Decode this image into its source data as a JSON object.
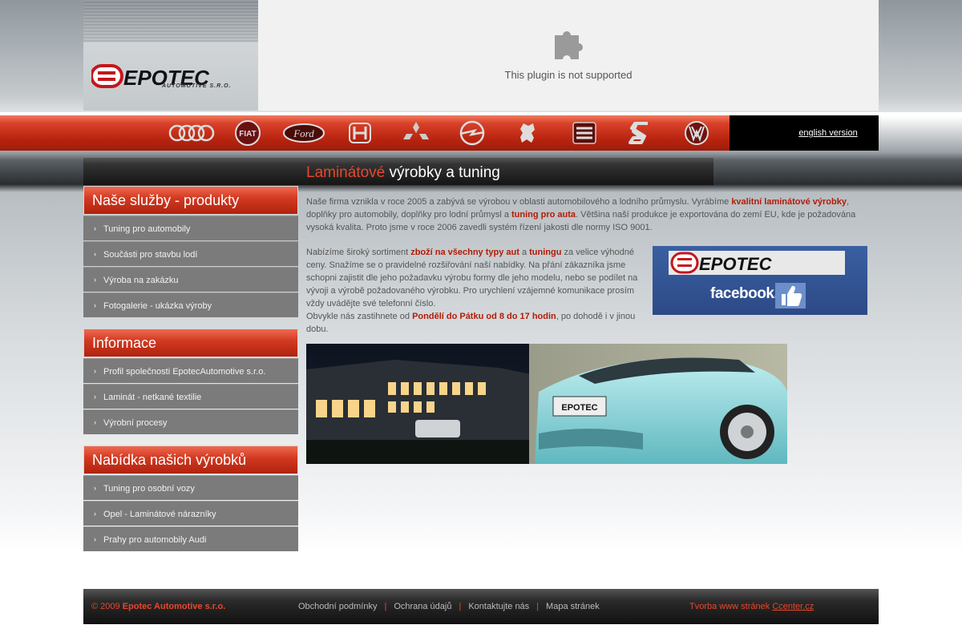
{
  "header": {
    "logo_text": "EPOTEC",
    "logo_subtext": "AUTOMOTIVE S.R.O.",
    "plugin_message": "This plugin is not supported"
  },
  "brands": [
    {
      "name": "audi-logo"
    },
    {
      "name": "fiat-logo"
    },
    {
      "name": "ford-logo"
    },
    {
      "name": "honda-logo"
    },
    {
      "name": "mitsubishi-logo"
    },
    {
      "name": "opel-logo"
    },
    {
      "name": "peugeot-logo"
    },
    {
      "name": "seat-logo"
    },
    {
      "name": "suzuki-logo"
    },
    {
      "name": "volkswagen-logo"
    },
    {
      "name": "skoda-logo"
    }
  ],
  "english_link": "english version",
  "page_title": {
    "highlight": "Laminátové",
    "rest": " výrobky a tuning"
  },
  "sidebar": {
    "sections": [
      {
        "title": "Naše služby - produkty",
        "items": [
          "Tuning pro automobily",
          "Součásti pro stavbu lodí",
          "Výroba na zakázku",
          "Fotogalerie - ukázka výroby"
        ]
      },
      {
        "title": "Informace",
        "items": [
          "Profil společnosti EpotecAutomotive s.r.o.",
          "Laminát - netkané textilie",
          "Výrobní procesy"
        ]
      },
      {
        "title": "Nabídka našich výrobků",
        "items": [
          "Tuning pro osobní vozy",
          "Opel - Laminátové nárazníky",
          "Prahy pro automobily Audi"
        ]
      }
    ]
  },
  "content": {
    "p1_a": "Naše firma vznikla v roce 2005 a zabývá se výrobou v oblasti automobilového a lodního průmyslu. Vyrábíme ",
    "p1_b": "kvalitní laminátové výrobky",
    "p1_c": ", doplňky pro automobily, doplňky pro lodní průmysl a ",
    "p1_d": "tuning pro auta",
    "p1_e": ". Většina naší produkce je exportována do zemí EU, kde je požadována vysoká kvalita. Proto jsme v roce 2006 zavedli systém řízení jakosti dle normy ISO 9001.",
    "p2_a": "Nabízíme široký sortiment ",
    "p2_b": "zboží na všechny typy aut",
    "p2_c": " a ",
    "p2_d": "tuningu",
    "p2_e": " za velice výhodné ceny. Snažíme se o pravidelné rozšiřování naší nabídky. Na přání zákazníka jsme schopni zajistit dle jeho požadavku výrobu formy dle jeho modelu, nebo se podílet na vývoji a výrobě požadovaného výrobku. Pro urychlení vzájemné komunikace prosím vždy uvádějte své telefonní číslo.",
    "p3_a": "Obvykle nás zastihnete od ",
    "p3_b": "Pondělí do Pátku od 8 do 17 hodin",
    "p3_c": ", po dohodě i v jinou dobu.",
    "facebook_text": "facebook."
  },
  "footer": {
    "copyright_year": "© 2009 ",
    "company": "Epotec Automotive s.r.o.",
    "links": [
      "Obchodní podmínky",
      "Ochrana údajů",
      "Kontaktujte nás",
      "Mapa stránek"
    ],
    "credit_prefix": "Tvorba www stránek ",
    "credit_link": "Ccenter.cz"
  },
  "colors": {
    "accent": "#b21c08",
    "footer_red": "#e8472c"
  }
}
